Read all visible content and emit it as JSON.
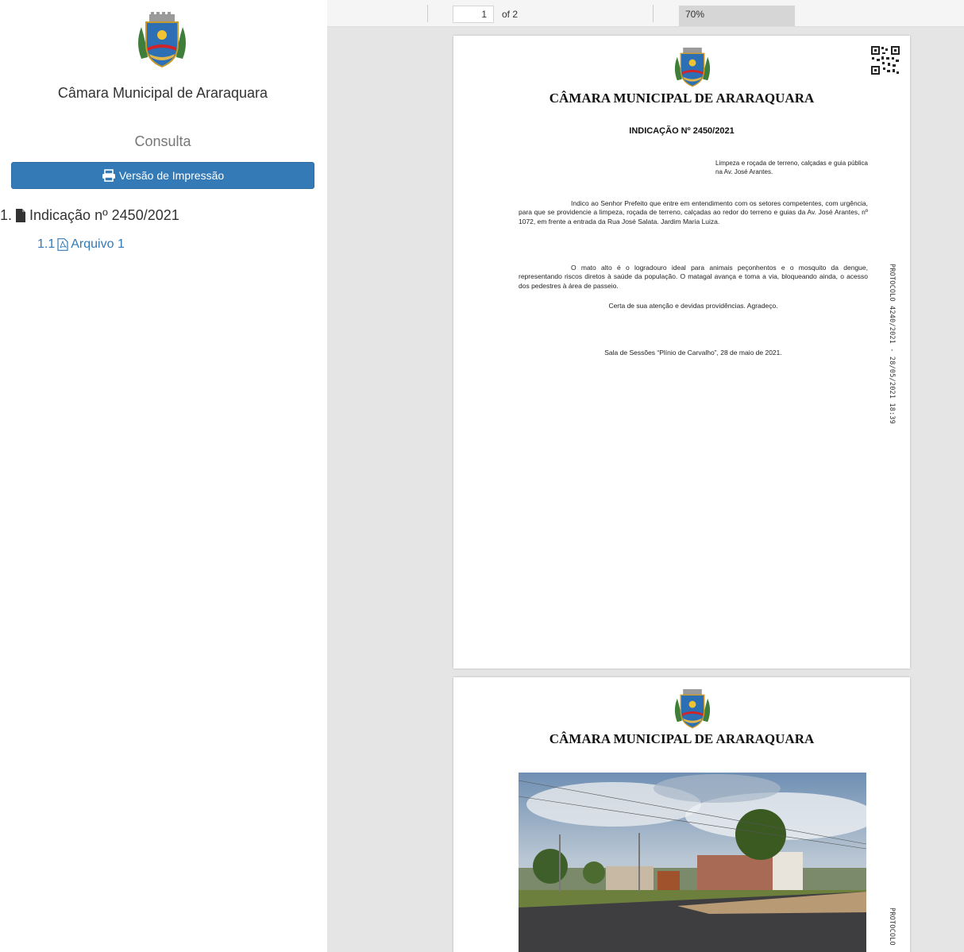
{
  "sidebar": {
    "org_name": "Câmara Municipal de Araraquara",
    "section_title": "Consulta",
    "print_button_label": "Versão de Impressão",
    "tree": {
      "root_number": "1.",
      "root_label": "Indicação nº 2450/2021",
      "child_number": "1.1",
      "child_label": "Arquivo 1"
    }
  },
  "viewer": {
    "toolbar": {
      "page_current": "1",
      "page_total_label": "of 2",
      "zoom": "70%"
    },
    "page1": {
      "header_title": "CÂMARA MUNICIPAL DE ARARAQUARA",
      "doc_title": "INDICAÇÃO Nº 2450/2021",
      "ementa": "Limpeza e roçada de terreno, calçadas e guia pública na Av. José Arantes.",
      "paragraph1": "Indico ao Senhor Prefeito que entre em entendimento com os setores competentes, com urgência, para que se providencie a limpeza, roçada de terreno, calçadas ao redor do terreno e guias da Av. José Arantes, nº 1072, em frente a entrada da Rua José Salata. Jardim Maria Luiza.",
      "paragraph2": "O mato alto é o logradouro ideal para animais peçonhentos e o mosquito da dengue, representando riscos diretos à saúde da população. O matagal avança e toma a via, bloqueando ainda, o acesso dos pedestres à área de passeio.",
      "closing": "Certa de sua atenção e devidas providências. Agradeço.",
      "signature_place": "Sala de Sessões “Plínio de Carvalho”, 28 de maio de 2021.",
      "protocol_stamp": "PROTOCOLO 4240/2021 - 28/05/2021 18:39"
    },
    "page2": {
      "header_title": "CÂMARA MUNICIPAL DE ARARAQUARA",
      "protocol_stamp": "PROTOCOLO"
    }
  },
  "colors": {
    "primary": "#337ab7",
    "viewer_background": "#e5e5e5"
  }
}
